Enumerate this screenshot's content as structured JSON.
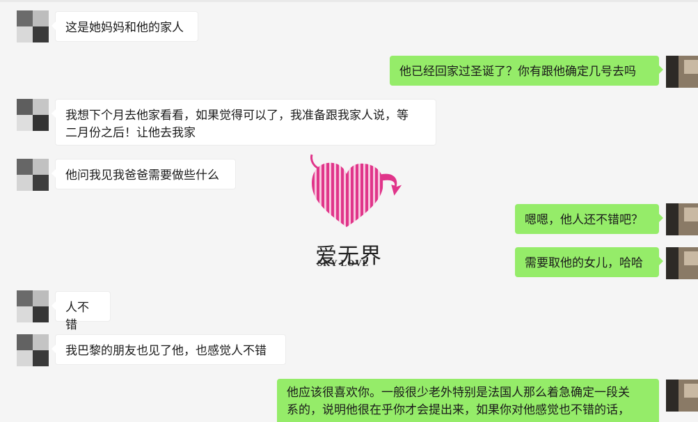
{
  "messages": [
    {
      "side": "in",
      "text": "这是她妈妈和他的家人"
    },
    {
      "side": "out",
      "text": "他已经回家过圣诞了？你有跟他确定几号去吗"
    },
    {
      "side": "in",
      "text": "我想下个月去他家看看，如果觉得可以了，我准备跟我家人说，等\n二月份之后！让他去我家"
    },
    {
      "side": "in",
      "text": "他问我见我爸爸需要做些什么"
    },
    {
      "side": "out",
      "text": "嗯嗯，他人还不错吧？"
    },
    {
      "side": "out",
      "text": "需要取他的女儿，哈哈"
    },
    {
      "side": "in",
      "text": "人不错"
    },
    {
      "side": "in",
      "text": "我巴黎的朋友也见了他，也感觉人不错"
    },
    {
      "side": "out",
      "text": "他应该很喜欢你。一般很少老外特别是法国人那么着急确定一段关\n系的，说明他很在乎你才会提出来，如果你对他感觉也不错的话，"
    }
  ],
  "watermark": {
    "title": "爱无界",
    "subtitle": "SKY LOVE",
    "heart_color": "#e0358a"
  },
  "colors": {
    "background": "#f5f5f5",
    "incoming_bubble": "#ffffff",
    "outgoing_bubble": "#95ec69"
  }
}
